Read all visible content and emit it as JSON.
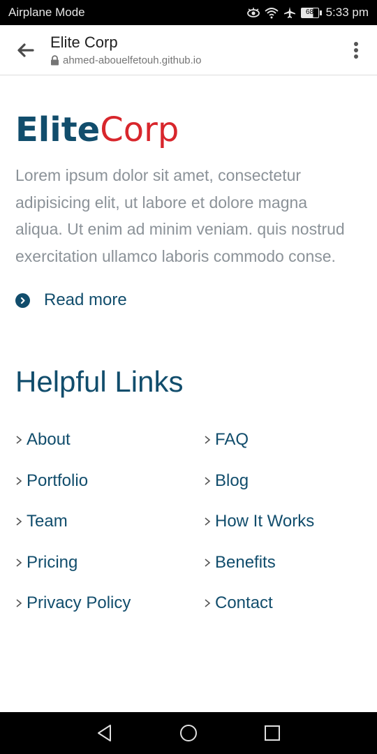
{
  "status_bar": {
    "carrier_text": "Airplane Mode",
    "battery_level": "68",
    "time": "5:33 pm",
    "icons": [
      "eye-icon",
      "wifi-icon",
      "airplane-icon",
      "battery-icon"
    ]
  },
  "browser": {
    "page_title": "Elite Corp",
    "url": "ahmed-abouelfetouh.github.io",
    "icons": [
      "back-arrow-icon",
      "lock-icon",
      "more-vert-icon"
    ]
  },
  "hero": {
    "logo_part1": "Elite",
    "logo_part2": "Corp",
    "paragraph": "Lorem ipsum dolor sit amet, consectetur adipisicing elit, ut labore et dolore magna aliqua. Ut enim ad minim veniam. quis nostrud exercitation ullamco laboris commodo conse.",
    "read_more_label": "Read more"
  },
  "links": {
    "heading": "Helpful Links",
    "items": [
      {
        "label": "About"
      },
      {
        "label": "FAQ"
      },
      {
        "label": "Portfolio"
      },
      {
        "label": "Blog"
      },
      {
        "label": "Team"
      },
      {
        "label": "How It Works"
      },
      {
        "label": "Pricing"
      },
      {
        "label": "Benefits"
      },
      {
        "label": "Privacy Policy"
      },
      {
        "label": "Contact"
      }
    ]
  },
  "nav_bar": {
    "icons": [
      "back-triangle-icon",
      "home-circle-icon",
      "recents-square-icon"
    ]
  },
  "colors": {
    "brand_primary": "#114d6c",
    "brand_accent": "#d8262c",
    "body_text": "#8b9298"
  }
}
